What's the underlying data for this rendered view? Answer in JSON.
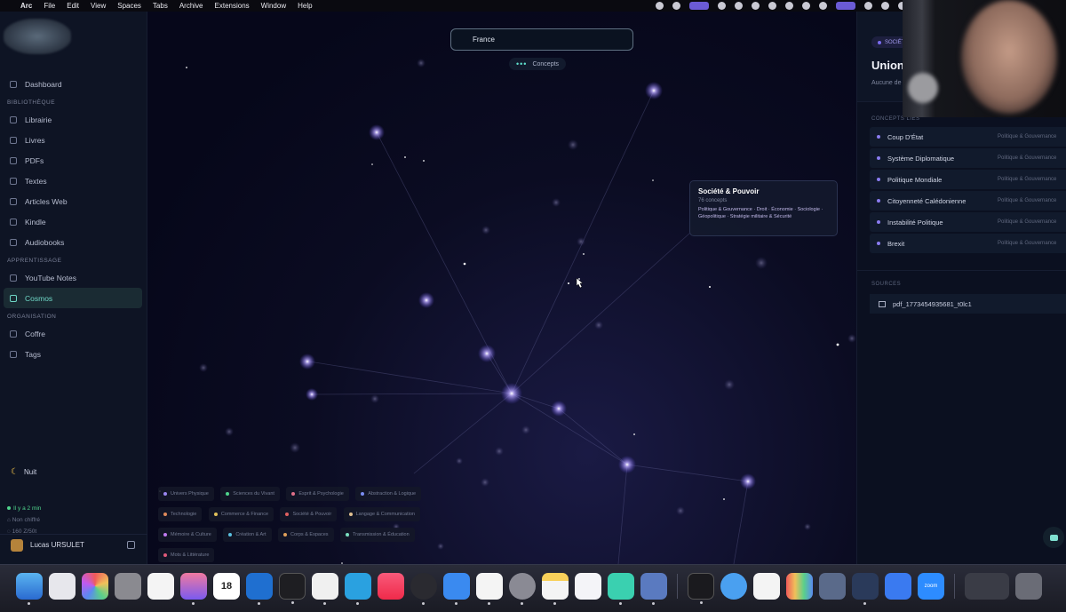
{
  "menubar": {
    "app": "Arc",
    "items": [
      "File",
      "Edit",
      "View",
      "Spaces",
      "Tabs",
      "Archive",
      "Extensions",
      "Window",
      "Help"
    ]
  },
  "sidebar": {
    "dashboard": "Dashboard",
    "section_library": "BIBLIOTHÈQUE",
    "library": [
      "Librairie",
      "Livres",
      "PDFs",
      "Textes",
      "Articles Web",
      "Kindle",
      "Audiobooks"
    ],
    "section_learning": "APPRENTISSAGE",
    "learning": [
      "YouTube Notes",
      "Cosmos"
    ],
    "section_org": "ORGANISATION",
    "org": [
      "Coffre",
      "Tags"
    ],
    "theme_label": "Nuit",
    "status": [
      "Il y a 2 min",
      "Non chiffré",
      "160 Z/50t"
    ],
    "user_name": "Lucas URSULET"
  },
  "canvas": {
    "search_value": "France",
    "concepts_label": "Concepts",
    "tooltip": {
      "title": "Société & Pouvoir",
      "count": "76 concepts",
      "desc": "Politique & Gouvernance · Droit · Économie · Sociologie · Géopolitique · Stratégie militaire & Sécurité"
    },
    "legend": [
      {
        "label": "Univers Physique",
        "color": "#9a86f0"
      },
      {
        "label": "Sciences du Vivant",
        "color": "#4fd48c"
      },
      {
        "label": "Esprit & Psychologie",
        "color": "#e0708a"
      },
      {
        "label": "Abstraction & Logique",
        "color": "#7a8cf0"
      },
      {
        "label": "Technologie",
        "color": "#e08a5a"
      },
      {
        "label": "Commerce & Finance",
        "color": "#e0c05a"
      },
      {
        "label": "Société & Pouvoir",
        "color": "#e06060"
      },
      {
        "label": "Langage & Communication",
        "color": "#e0c090"
      },
      {
        "label": "Mémoire & Culture",
        "color": "#c07af0"
      },
      {
        "label": "Création & Art",
        "color": "#5ac0e0"
      },
      {
        "label": "Corps & Espaces",
        "color": "#e0a05a"
      },
      {
        "label": "Transmission & Éducation",
        "color": "#7ae0c0"
      },
      {
        "label": "Mots & Littérature",
        "color": "#e05a7a"
      }
    ]
  },
  "right_panel": {
    "badge": "SOCIÉTÉ",
    "title": "Union",
    "subtitle": "Aucune de",
    "related_label": "CONCEPTS LIÉS",
    "related": [
      {
        "name": "Coup D'État",
        "category": "Politique & Gouvernance"
      },
      {
        "name": "Système Diplomatique",
        "category": "Politique & Gouvernance"
      },
      {
        "name": "Politique Mondiale",
        "category": "Politique & Gouvernance"
      },
      {
        "name": "Citoyenneté Calédonienne",
        "category": "Politique & Gouvernance"
      },
      {
        "name": "Instabilité Politique",
        "category": "Politique & Gouvernance"
      },
      {
        "name": "Brexit",
        "category": "Politique & Gouvernance"
      }
    ],
    "sources_label": "SOURCES",
    "source_file": "pdf_1773454935681_t0lc1"
  },
  "dock": {
    "calendar_day": "18",
    "zoom_label": "zoom"
  }
}
